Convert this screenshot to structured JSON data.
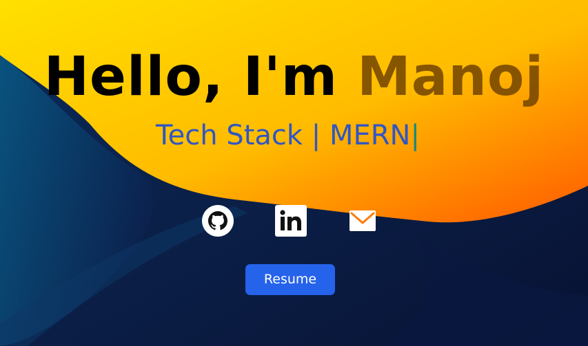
{
  "hero": {
    "greeting": "Hello, I'm",
    "name": "Manoj",
    "subtitle": "Tech Stack | MERN",
    "cursor": "|"
  },
  "socials": [
    {
      "icon": "github-icon"
    },
    {
      "icon": "linkedin-icon"
    },
    {
      "icon": "mail-icon"
    }
  ],
  "resume": {
    "label": "Resume"
  },
  "colors": {
    "accent_yellow": "#ffd400",
    "accent_orange": "#ff6a00",
    "navy": "#0b1a3e",
    "title_text": "#000000",
    "name_text": "#7a4a00",
    "subtitle_text": "#2f56c4",
    "button_bg": "#2563eb"
  }
}
